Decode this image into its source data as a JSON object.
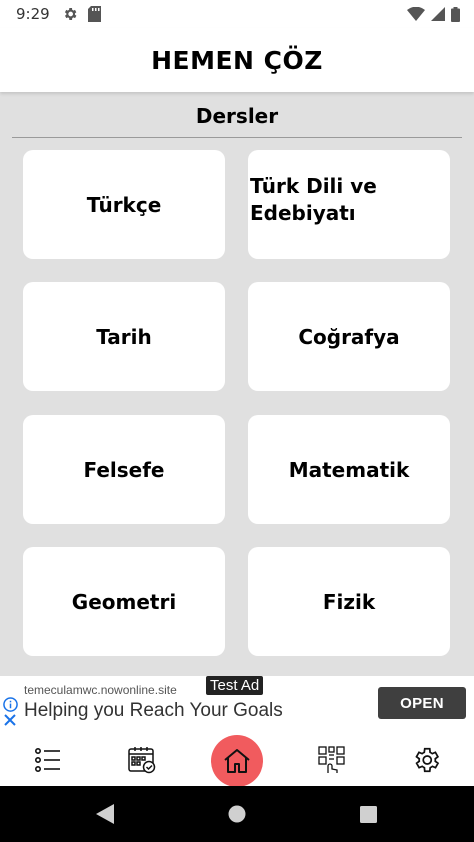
{
  "status_bar": {
    "time": "9:29",
    "icons": [
      "gear-icon",
      "sd-card-icon",
      "wifi-icon",
      "signal-icon",
      "battery-icon"
    ]
  },
  "header": {
    "title": "HEMEN ÇÖZ"
  },
  "main": {
    "section_title": "Dersler",
    "cards": [
      {
        "label": "Türkçe"
      },
      {
        "label": "Türk Dili ve Edebiyatı"
      },
      {
        "label": "Tarih"
      },
      {
        "label": "Coğrafya"
      },
      {
        "label": "Felsefe"
      },
      {
        "label": "Matematik"
      },
      {
        "label": "Geometri"
      },
      {
        "label": "Fizik"
      }
    ]
  },
  "ad": {
    "badge": "Test Ad",
    "domain": "temeculamwc.nowonline.site",
    "headline": "Helping you Reach Your Goals",
    "cta": "OPEN",
    "icons": [
      "info-icon",
      "close-icon"
    ]
  },
  "bottom_nav": {
    "items": [
      "list-icon",
      "calendar-icon",
      "home-icon",
      "quiz-icon",
      "settings-icon"
    ],
    "active": "home-icon"
  },
  "system_nav": [
    "back-icon",
    "home-circle-icon",
    "recents-icon"
  ],
  "colors": {
    "content_background": "#e0e0e0",
    "card_background": "#ffffff",
    "home_button": "#f15b5e",
    "ad_button": "#3f3f3f",
    "system_bar": "#000000"
  }
}
